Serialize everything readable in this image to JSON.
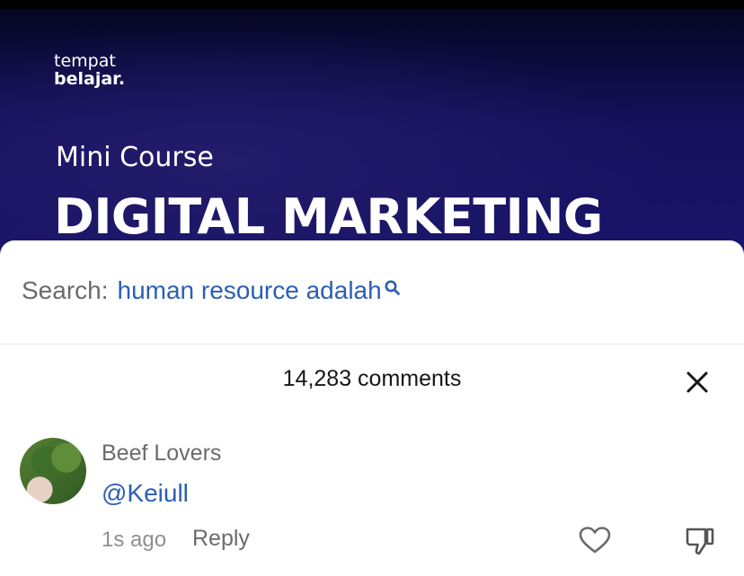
{
  "video": {
    "brand_line1": "tempat",
    "brand_line2": "belajar.",
    "subtitle": "Mini Course",
    "title": "DIGITAL MARKETING"
  },
  "search": {
    "prefix": "Search:",
    "term": "human resource adalah",
    "icon": "search-icon"
  },
  "comments": {
    "count_label": "14,283 comments",
    "close_icon": "close-icon",
    "items": [
      {
        "username": "Beef Lovers",
        "text": "@Keiull",
        "time": "1s ago",
        "reply_label": "Reply",
        "like_icon": "heart-outline-icon",
        "dislike_icon": "thumbs-down-icon"
      }
    ]
  },
  "colors": {
    "mention_blue": "#2b5fb3",
    "muted_text": "#6b6b6b",
    "video_bg": "#14105a"
  }
}
